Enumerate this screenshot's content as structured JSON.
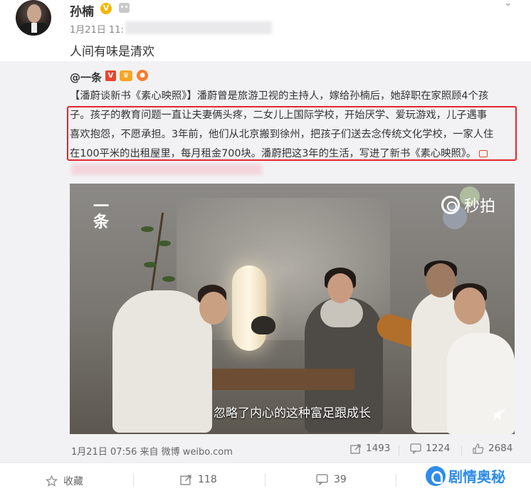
{
  "post": {
    "author": "孙楠",
    "verified_badge": "V",
    "time": "1月21日 11:",
    "text": "人间有味是清欢"
  },
  "repost": {
    "author": "@一条",
    "badge_v": "V",
    "body_line1": "【潘蔚谈新书《素心映照》】潘蔚曾是旅游卫视的主持人，嫁给孙楠后，她辞职在家照顾4个孩",
    "body_line2": "子。孩子的教育问题一直让夫妻俩头疼，二女儿上国际学校，开始厌学、爱玩游戏，儿子遇事",
    "body_line3": "喜欢抱怨，不愿承担。3年前，他们从北京搬到徐州，把孩子们送去念传统文化学校，一家人住",
    "body_line4": "在100平米的出租屋里，每月租金700块。潘蔚把这3年的生活，写进了新书《素心映照》。",
    "video": {
      "logo_left": "一条",
      "logo_right": "秒拍",
      "subtitle": "忽略了内心的这种富足跟成长"
    },
    "meta": "1月21日 07:56 来自 微博 weibo.com",
    "reposts": "1493",
    "comments": "1224",
    "likes": "2684"
  },
  "actions": {
    "favorite": "收藏",
    "repost": "118",
    "comment": "39"
  },
  "watermark": "剧情奥秘",
  "colors": {
    "highlight_box": "#e3262c",
    "repost_bg": "#f2f2f5",
    "watermark": "#2f8ce8"
  }
}
